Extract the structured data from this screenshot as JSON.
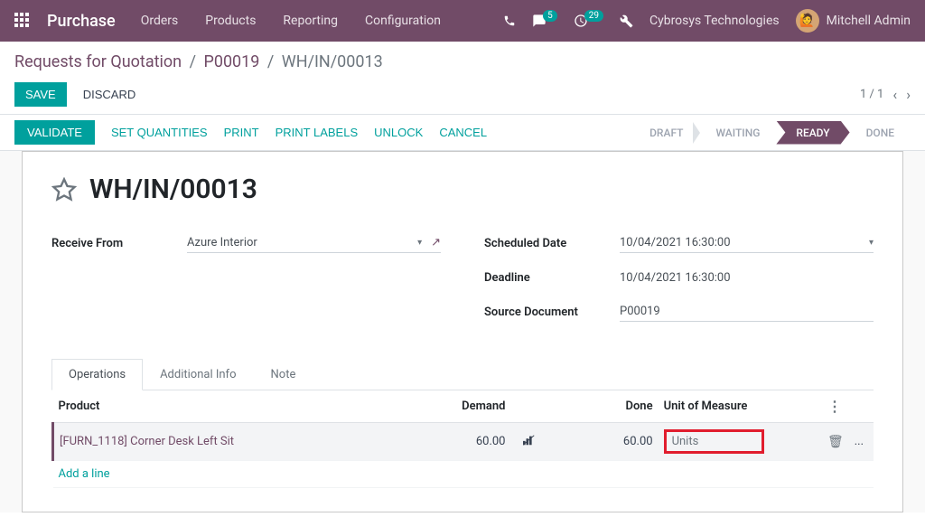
{
  "navbar": {
    "brand": "Purchase",
    "menu": [
      "Orders",
      "Products",
      "Reporting",
      "Configuration"
    ],
    "badge_messages": "5",
    "badge_activities": "29",
    "company": "Cybrosys Technologies",
    "user": "Mitchell Admin",
    "avatar_emoji": "🙋"
  },
  "breadcrumb": {
    "items": [
      "Requests for Quotation",
      "P00019"
    ],
    "current": "WH/IN/00013"
  },
  "actions": {
    "save": "SAVE",
    "discard": "DISCARD"
  },
  "pager": {
    "text": "1 / 1"
  },
  "statusbar": {
    "buttons": {
      "validate": "VALIDATE",
      "set_qty": "SET QUANTITIES",
      "print": "PRINT",
      "print_labels": "PRINT LABELS",
      "unlock": "UNLOCK",
      "cancel": "CANCEL"
    },
    "steps": {
      "draft": "DRAFT",
      "waiting": "WAITING",
      "ready": "READY",
      "done": "DONE"
    }
  },
  "doc": {
    "title": "WH/IN/00013",
    "fields": {
      "receive_from_label": "Receive From",
      "receive_from_value": "Azure Interior",
      "scheduled_date_label": "Scheduled Date",
      "scheduled_date_value": "10/04/2021 16:30:00",
      "deadline_label": "Deadline",
      "deadline_value": "10/04/2021 16:30:00",
      "source_doc_label": "Source Document",
      "source_doc_value": "P00019"
    }
  },
  "tabs": {
    "operations": "Operations",
    "additional": "Additional Info",
    "note": "Note"
  },
  "table": {
    "headers": {
      "product": "Product",
      "demand": "Demand",
      "done": "Done",
      "uom": "Unit of Measure"
    },
    "row": {
      "product": "[FURN_1118] Corner Desk Left Sit",
      "demand": "60.00",
      "done": "60.00",
      "uom": "Units"
    },
    "add_line": "Add a line",
    "trash": "🗑",
    "more": "..."
  }
}
